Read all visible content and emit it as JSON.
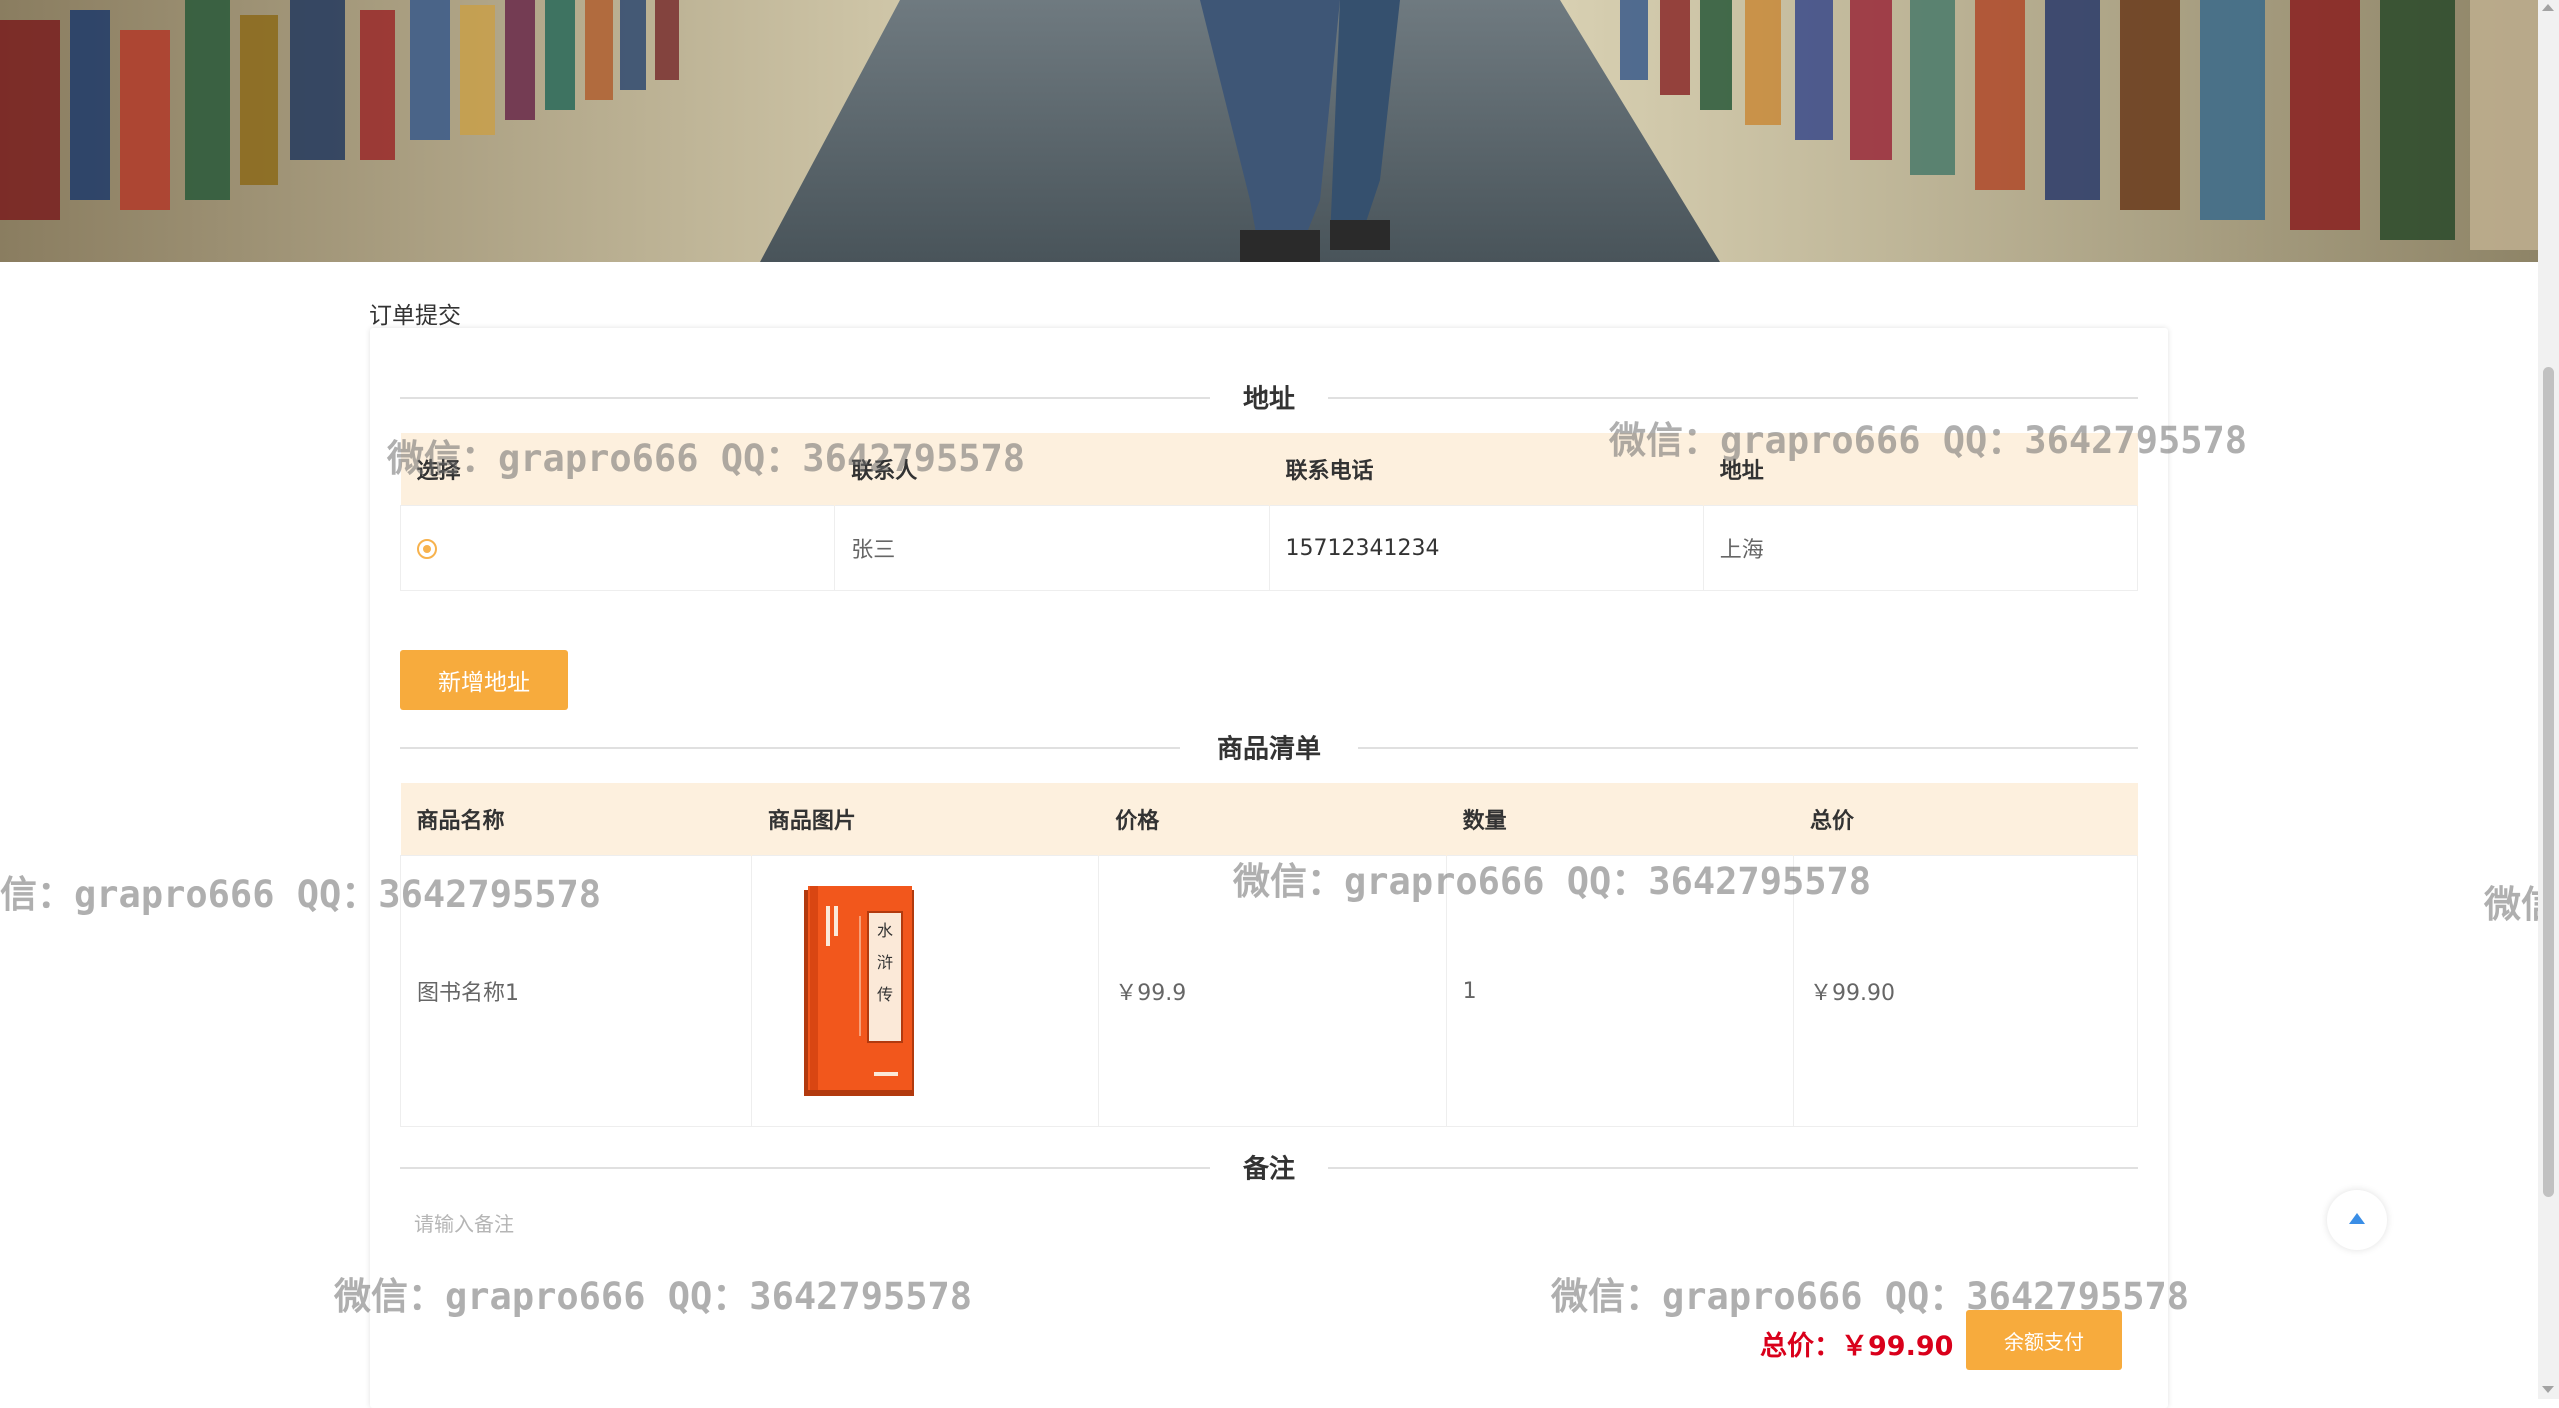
{
  "breadcrumb": "订单提交",
  "address_section": {
    "title": "地址",
    "headers": [
      "选择",
      "联系人",
      "联系电话",
      "地址"
    ],
    "rows": [
      {
        "contact": "张三",
        "phone": "15712341234",
        "address": "上海",
        "selected": true
      }
    ],
    "add_button": "新增地址"
  },
  "goods_section": {
    "title": "商品清单",
    "headers": [
      "商品名称",
      "商品图片",
      "价格",
      "数量",
      "总价"
    ],
    "rows": [
      {
        "name": "图书名称1",
        "image_icon": "book-cover-icon",
        "book_title": "水浒传",
        "price": "￥99.9",
        "quantity": "1",
        "total": "￥99.90"
      }
    ]
  },
  "remark_section": {
    "title": "备注",
    "placeholder": "请输入备注",
    "value": ""
  },
  "summary": {
    "total_label": "总价：￥99.90",
    "pay_button": "余额支付"
  },
  "back_to_top_icon": "arrow-up-icon",
  "watermarks": [
    "微信：grapro666 QQ：3642795578",
    "微信：grapro666 QQ：3642795578",
    "信：grapro666 QQ：3642795578",
    "微信：grapro666 QQ：3642795578",
    "微信",
    "微信：grapro666 QQ：3642795578",
    "微信：grapro666 QQ：3642795578"
  ],
  "colors": {
    "accent": "#f7ab3d",
    "header_bg": "#fdf0de",
    "total": "#d9001b",
    "back_top": "#3a8ee6"
  }
}
